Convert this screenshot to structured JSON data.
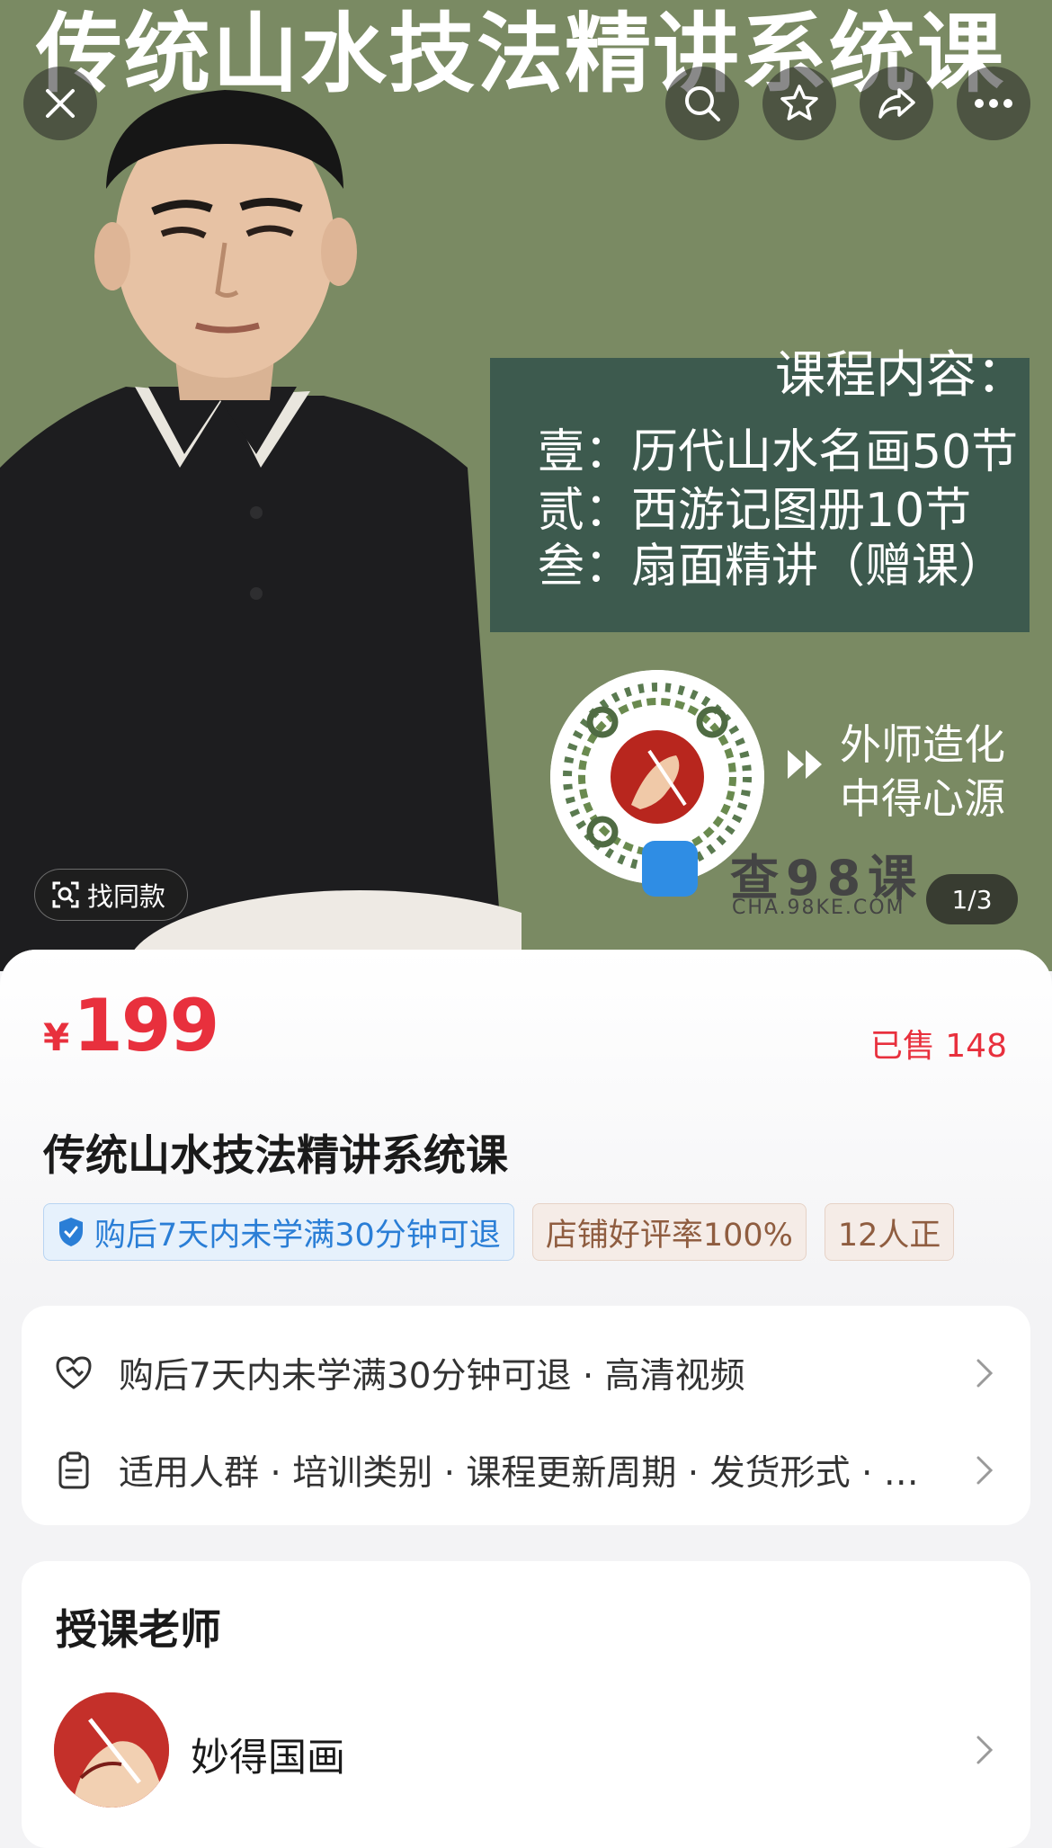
{
  "hero": {
    "banner_text": "传统山水技法精讲系统课",
    "course_box": {
      "title": "课程内容：",
      "lines": [
        "壹：历代山水名画50节",
        "贰：西游记图册10节",
        "叁：扇面精讲（赠课）"
      ]
    },
    "motto": [
      "外师造化",
      "中得心源"
    ],
    "watermark": {
      "text": "查98课",
      "url": "CHA.98KE.COM"
    },
    "find_same_label": "找同款",
    "pager": "1/3"
  },
  "toolbar": {
    "icons": [
      "close-icon",
      "search-icon",
      "star-icon",
      "share-icon",
      "more-icon"
    ]
  },
  "product": {
    "price_symbol": "¥",
    "price": "199",
    "sold": "已售 148",
    "title": "传统山水技法精讲系统课",
    "tags": [
      {
        "text": "购后7天内未学满30分钟可退",
        "style": "blue",
        "icon": "shield-check-icon"
      },
      {
        "text": "店铺好评率100%",
        "style": "brown"
      },
      {
        "text": "12人正",
        "style": "brown"
      }
    ]
  },
  "info": {
    "rows": [
      {
        "icon": "heart-refund-icon",
        "text": "购后7天内未学满30分钟可退 · 高清视频"
      },
      {
        "icon": "clipboard-icon",
        "text": "适用人群 · 培训类别 · 课程更新周期 · 发货形式 · …"
      }
    ]
  },
  "teacher": {
    "heading": "授课老师",
    "name": "妙得国画"
  },
  "colors": {
    "hero_bg": "#7a8a63",
    "course_box": "#3d5a4e",
    "price_red": "#e8303d",
    "tag_blue": "#2a7ed6",
    "tag_brown": "#8f5d40"
  }
}
